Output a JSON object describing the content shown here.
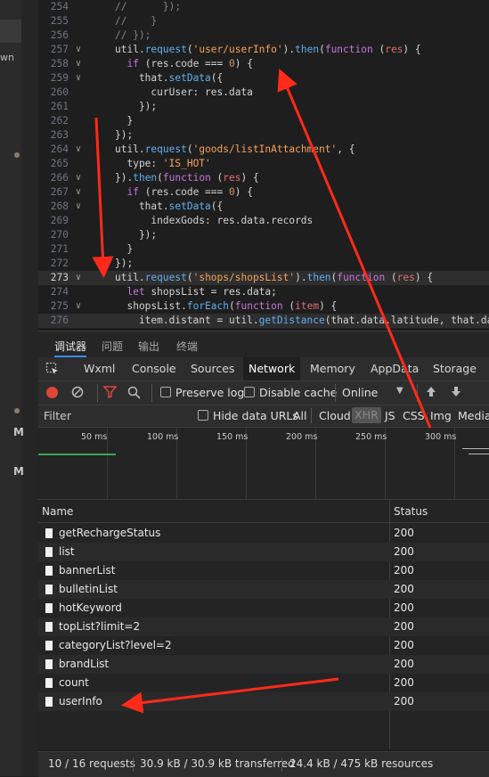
{
  "sidebar": {
    "fragment": "wn",
    "markers": [
      "M",
      "M"
    ]
  },
  "editor": {
    "lines": [
      {
        "n": "254",
        "fold": "",
        "hl": false,
        "cur": false,
        "t": [
          [
            "c",
            "//      });"
          ]
        ]
      },
      {
        "n": "255",
        "fold": "",
        "hl": false,
        "cur": false,
        "t": [
          [
            "c",
            "//    }"
          ]
        ]
      },
      {
        "n": "256",
        "fold": "",
        "hl": false,
        "cur": false,
        "t": [
          [
            "c",
            "// });"
          ]
        ]
      },
      {
        "n": "257",
        "fold": "v",
        "hl": false,
        "cur": false,
        "t": [
          [
            "",
            "util."
          ],
          [
            "f",
            "request"
          ],
          [
            "",
            "("
          ],
          [
            "s",
            "'user/userInfo'"
          ],
          [
            "",
            ")."
          ],
          [
            "f",
            "then"
          ],
          [
            "",
            "("
          ],
          [
            "k",
            "function"
          ],
          [
            "",
            " ("
          ],
          [
            "p",
            "res"
          ],
          [
            "",
            ") {"
          ]
        ]
      },
      {
        "n": "258",
        "fold": "v",
        "hl": false,
        "cur": false,
        "t": [
          [
            "",
            "  "
          ],
          [
            "k",
            "if"
          ],
          [
            "",
            " (res.code === "
          ],
          [
            "n",
            "0"
          ],
          [
            "",
            ") {"
          ]
        ]
      },
      {
        "n": "259",
        "fold": "v",
        "hl": false,
        "cur": false,
        "t": [
          [
            "",
            "    that."
          ],
          [
            "f",
            "setData"
          ],
          [
            "",
            "({"
          ]
        ]
      },
      {
        "n": "260",
        "fold": "",
        "hl": false,
        "cur": false,
        "t": [
          [
            "",
            "      curUser: res.data"
          ]
        ]
      },
      {
        "n": "261",
        "fold": "",
        "hl": false,
        "cur": false,
        "t": [
          [
            "",
            "    });"
          ]
        ]
      },
      {
        "n": "262",
        "fold": "",
        "hl": false,
        "cur": false,
        "t": [
          [
            "",
            "  }"
          ]
        ]
      },
      {
        "n": "263",
        "fold": "",
        "hl": false,
        "cur": false,
        "t": [
          [
            "",
            "});"
          ]
        ]
      },
      {
        "n": "264",
        "fold": "v",
        "hl": false,
        "cur": false,
        "t": [
          [
            "",
            "util."
          ],
          [
            "f",
            "request"
          ],
          [
            "",
            "("
          ],
          [
            "s",
            "'goods/listInAttachment'"
          ],
          [
            "",
            ", {"
          ]
        ]
      },
      {
        "n": "265",
        "fold": "",
        "hl": false,
        "cur": false,
        "t": [
          [
            "",
            "  type: "
          ],
          [
            "s",
            "'IS_HOT'"
          ]
        ]
      },
      {
        "n": "266",
        "fold": "v",
        "hl": false,
        "cur": false,
        "t": [
          [
            "",
            "})."
          ],
          [
            "f",
            "then"
          ],
          [
            "",
            "("
          ],
          [
            "k",
            "function"
          ],
          [
            "",
            " ("
          ],
          [
            "p",
            "res"
          ],
          [
            "",
            ") {"
          ]
        ]
      },
      {
        "n": "267",
        "fold": "v",
        "hl": false,
        "cur": false,
        "t": [
          [
            "",
            "  "
          ],
          [
            "k",
            "if"
          ],
          [
            "",
            " (res.code === "
          ],
          [
            "n",
            "0"
          ],
          [
            "",
            ") {"
          ]
        ]
      },
      {
        "n": "268",
        "fold": "v",
        "hl": false,
        "cur": false,
        "t": [
          [
            "",
            "    that."
          ],
          [
            "f",
            "setData"
          ],
          [
            "",
            "({"
          ]
        ]
      },
      {
        "n": "269",
        "fold": "",
        "hl": false,
        "cur": false,
        "t": [
          [
            "",
            "      indexGods: res.data.records"
          ]
        ]
      },
      {
        "n": "270",
        "fold": "",
        "hl": false,
        "cur": false,
        "t": [
          [
            "",
            "    });"
          ]
        ]
      },
      {
        "n": "271",
        "fold": "",
        "hl": false,
        "cur": false,
        "t": [
          [
            "",
            "  }"
          ]
        ]
      },
      {
        "n": "272",
        "fold": "",
        "hl": false,
        "cur": false,
        "t": [
          [
            "",
            "});"
          ]
        ]
      },
      {
        "n": "273",
        "fold": "v",
        "hl": true,
        "cur": true,
        "t": [
          [
            "",
            "util."
          ],
          [
            "f",
            "request"
          ],
          [
            "",
            "("
          ],
          [
            "s",
            "'shops/shopsList'"
          ],
          [
            "",
            ")."
          ],
          [
            "f",
            "then"
          ],
          [
            "",
            "("
          ],
          [
            "k",
            "function"
          ],
          [
            "",
            " ("
          ],
          [
            "p",
            "res"
          ],
          [
            "",
            ") {"
          ]
        ]
      },
      {
        "n": "274",
        "fold": "",
        "hl": false,
        "cur": false,
        "t": [
          [
            "",
            "  "
          ],
          [
            "k",
            "let"
          ],
          [
            "",
            " shopsList = res.data;"
          ]
        ]
      },
      {
        "n": "275",
        "fold": "v",
        "hl": false,
        "cur": false,
        "t": [
          [
            "",
            "  shopsList."
          ],
          [
            "f",
            "forEach"
          ],
          [
            "",
            "("
          ],
          [
            "k",
            "function"
          ],
          [
            "",
            " ("
          ],
          [
            "p",
            "item"
          ],
          [
            "",
            ") {"
          ]
        ]
      },
      {
        "n": "276",
        "fold": "",
        "hl": true,
        "cur": false,
        "t": [
          [
            "",
            "    item.distant = util."
          ],
          [
            "f",
            "getDistance"
          ],
          [
            "",
            "(that.data.latitude, that.data"
          ]
        ]
      }
    ]
  },
  "panel_tabs": [
    "调试器",
    "问题",
    "输出",
    "终端"
  ],
  "dev_tabs": [
    "Wxml",
    "Console",
    "Sources",
    "Network",
    "Memory",
    "AppData",
    "Storage"
  ],
  "toolbar": {
    "preserve_log": "Preserve log",
    "disable_cache": "Disable cache",
    "throttle": "Online"
  },
  "filter": {
    "placeholder": "Filter",
    "hide_data_urls": "Hide data URLs",
    "types": [
      "All",
      "Cloud",
      "XHR",
      "JS",
      "CSS",
      "Img",
      "Media"
    ]
  },
  "timeline": {
    "ticks": [
      "50 ms",
      "100 ms",
      "150 ms",
      "200 ms",
      "250 ms",
      "300 ms"
    ]
  },
  "table": {
    "headers": {
      "name": "Name",
      "status": "Status"
    },
    "rows": [
      {
        "name": "getRechargeStatus",
        "status": "200"
      },
      {
        "name": "list",
        "status": "200"
      },
      {
        "name": "bannerList",
        "status": "200"
      },
      {
        "name": "bulletinList",
        "status": "200"
      },
      {
        "name": "hotKeyword",
        "status": "200"
      },
      {
        "name": "topList?limit=2",
        "status": "200"
      },
      {
        "name": "categoryList?level=2",
        "status": "200"
      },
      {
        "name": "brandList",
        "status": "200"
      },
      {
        "name": "count",
        "status": "200"
      },
      {
        "name": "userInfo",
        "status": "200"
      }
    ]
  },
  "status_bar": {
    "requests": "10 / 16 requests",
    "transferred": "30.9 kB / 30.9 kB transferred",
    "resources": "24.4 kB / 475 kB resources"
  },
  "colors": {
    "accent": "#3b8cf0",
    "record": "#e0453a",
    "annotation_arrow": "#ff2a1a",
    "string": "#f7a35c",
    "keyword": "#c678dd",
    "function": "#61afef"
  }
}
